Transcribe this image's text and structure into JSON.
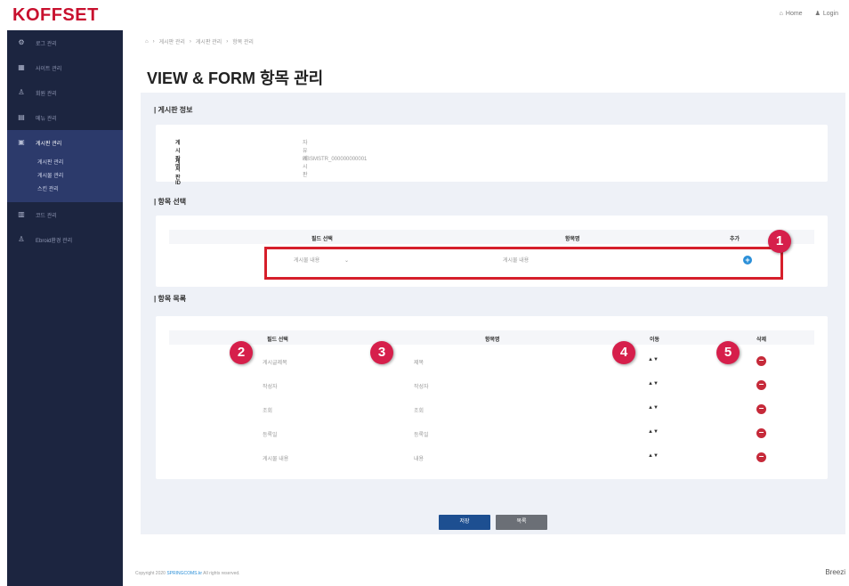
{
  "app": {
    "logo": "KOFFSET"
  },
  "top_links": {
    "home": "Home",
    "login": "Login"
  },
  "sidebar": {
    "items": [
      {
        "label": "로그 관리",
        "icon": "gear-icon"
      },
      {
        "label": "사이트 관리",
        "icon": "grid-icon"
      },
      {
        "label": "회원 관리",
        "icon": "user-icon"
      },
      {
        "label": "메뉴 관리",
        "icon": "menu-icon"
      },
      {
        "label": "게시판 관리",
        "icon": "board-icon"
      },
      {
        "label": "코드 관리",
        "icon": "code-icon"
      },
      {
        "label": "Ebroid환경 관리",
        "icon": "user-icon"
      }
    ],
    "sub_items": [
      "게시판 관리",
      "게시물 관리",
      "스킨 관리"
    ]
  },
  "breadcrumb": [
    "게시판 관리",
    "게시판 관리",
    "항목 관리"
  ],
  "page_title": "VIEW & FORM 항목 관리",
  "board_info": {
    "title": "게시판 정보",
    "rows": [
      {
        "label": "게시판명",
        "value": "자유게시판"
      },
      {
        "label": "게시판ID",
        "value": "BBSMSTR_000000000001"
      }
    ]
  },
  "field_select": {
    "title": "항목 선택",
    "headers": [
      "필드 선택",
      "항목명",
      "추가"
    ],
    "select_value": "게시물 내용",
    "name_value": "게시물 내용"
  },
  "field_list": {
    "title": "항목 목록",
    "headers": [
      "필드 선택",
      "항목명",
      "이동",
      "삭제"
    ],
    "rows": [
      {
        "field": "게시글제목",
        "name": "제목"
      },
      {
        "field": "작성자",
        "name": "작성자"
      },
      {
        "field": "조회",
        "name": "조회"
      },
      {
        "field": "등록일",
        "name": "등록일"
      },
      {
        "field": "게시물 내용",
        "name": "내용"
      }
    ],
    "move_glyph": "▲▼"
  },
  "buttons": {
    "save": "저장",
    "cancel": "목록"
  },
  "callouts": [
    "1",
    "2",
    "3",
    "4",
    "5"
  ],
  "footer": {
    "prefix": "Copyright 2020 ",
    "brand": "SPRINGCOMS.kr",
    "suffix": " All rights reserved."
  },
  "brand_mark": "Breezi",
  "colors": {
    "sidebar_bg": "#1c2540",
    "sidebar_active": "#2c3a6b",
    "accent_red": "#d61f2b",
    "badge": "#d61f4b",
    "primary": "#1d4f91",
    "add": "#2a8fd8",
    "delete": "#c62a3a"
  }
}
